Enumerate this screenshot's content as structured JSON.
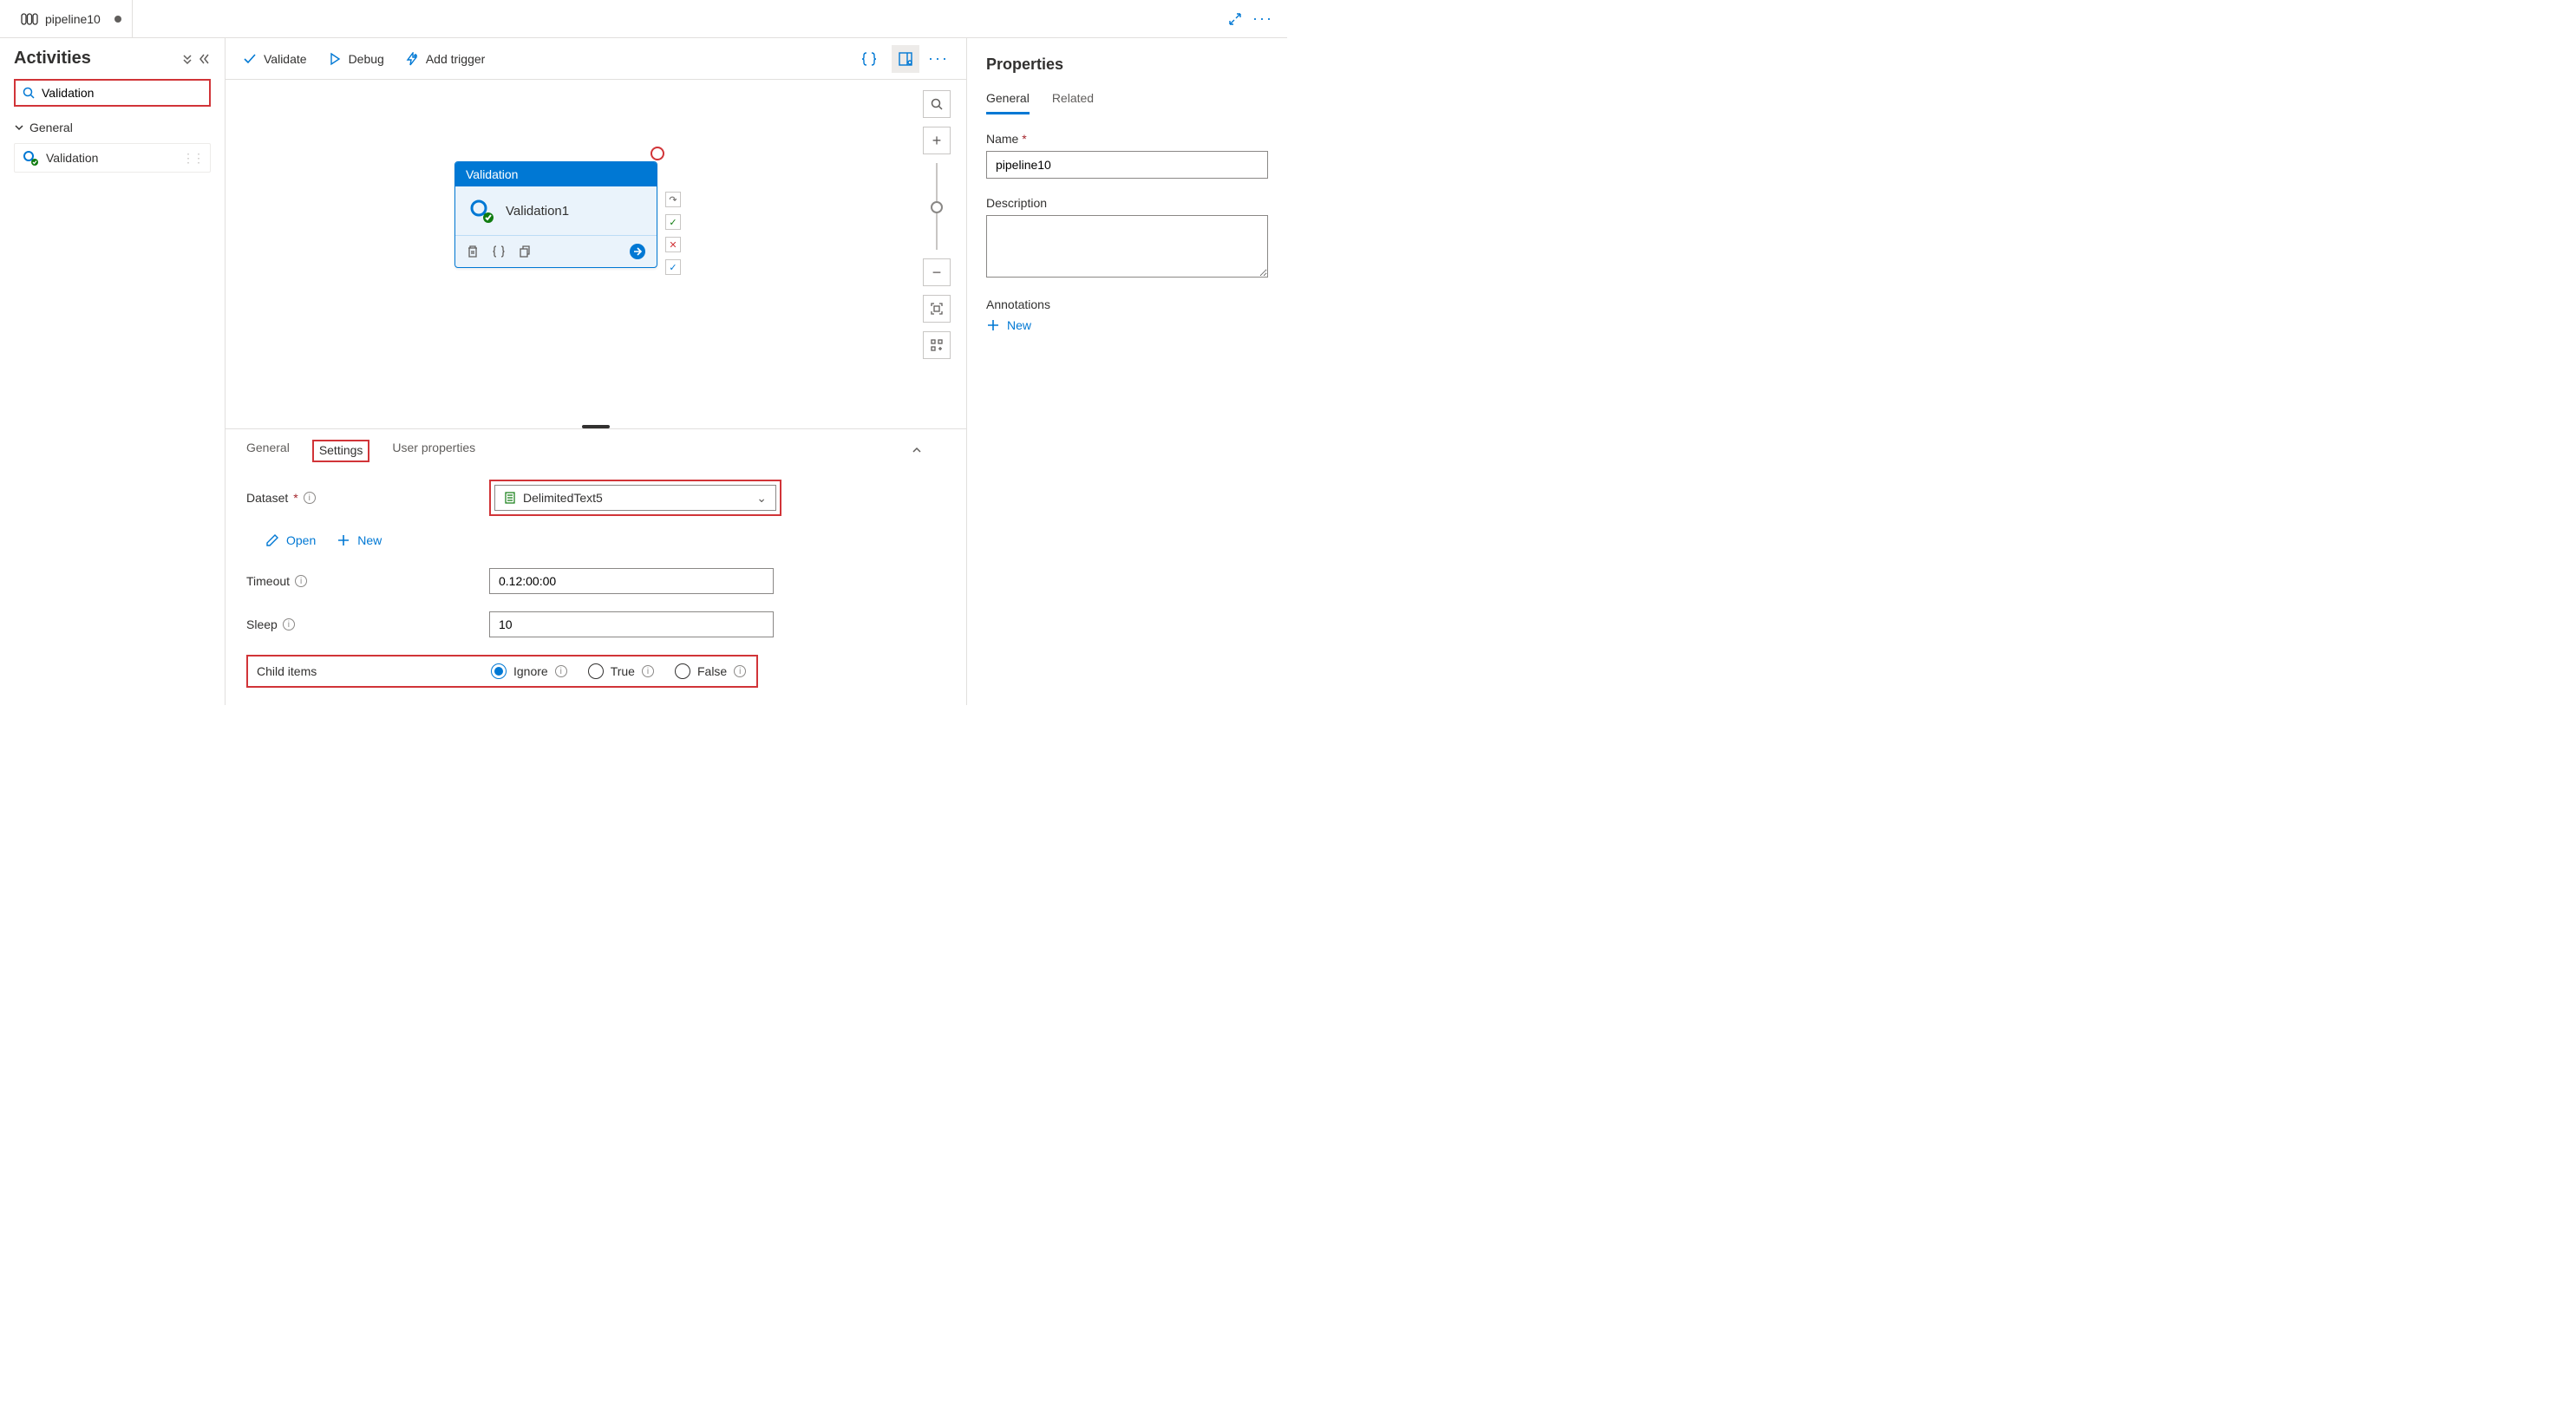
{
  "tab": {
    "title": "pipeline10"
  },
  "sidebar": {
    "title": "Activities",
    "search_value": "Validation",
    "category": "General",
    "activity_item": "Validation"
  },
  "toolbar": {
    "validate": "Validate",
    "debug": "Debug",
    "add_trigger": "Add trigger"
  },
  "node": {
    "header": "Validation",
    "name": "Validation1"
  },
  "bottom_tabs": {
    "general": "General",
    "settings": "Settings",
    "user_props": "User properties"
  },
  "settings": {
    "dataset_label": "Dataset",
    "dataset_value": "DelimitedText5",
    "open": "Open",
    "new": "New",
    "timeout_label": "Timeout",
    "timeout_value": "0.12:00:00",
    "sleep_label": "Sleep",
    "sleep_value": "10",
    "child_label": "Child items",
    "radio_ignore": "Ignore",
    "radio_true": "True",
    "radio_false": "False"
  },
  "properties": {
    "title": "Properties",
    "tab_general": "General",
    "tab_related": "Related",
    "name_label": "Name",
    "name_value": "pipeline10",
    "desc_label": "Description",
    "desc_value": "",
    "ann_label": "Annotations",
    "ann_new": "New"
  }
}
